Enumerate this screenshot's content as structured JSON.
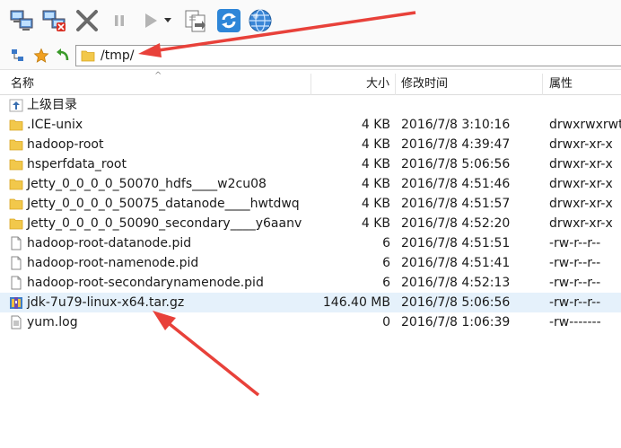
{
  "address": {
    "path": "/tmp/"
  },
  "columns": {
    "name": "名称",
    "size": "大小",
    "modified": "修改时间",
    "attributes": "属性"
  },
  "parent_dir": {
    "label": "上级目录"
  },
  "files": [
    {
      "type": "folder",
      "name": ".ICE-unix",
      "size": "4 KB",
      "modified": "2016/7/8 3:10:16",
      "attributes": "drwxrwxrwt"
    },
    {
      "type": "folder",
      "name": "hadoop-root",
      "size": "4 KB",
      "modified": "2016/7/8 4:39:47",
      "attributes": "drwxr-xr-x"
    },
    {
      "type": "folder",
      "name": "hsperfdata_root",
      "size": "4 KB",
      "modified": "2016/7/8 5:06:56",
      "attributes": "drwxr-xr-x"
    },
    {
      "type": "folder",
      "name": "Jetty_0_0_0_0_50070_hdfs____w2cu08",
      "size": "4 KB",
      "modified": "2016/7/8 4:51:46",
      "attributes": "drwxr-xr-x"
    },
    {
      "type": "folder",
      "name": "Jetty_0_0_0_0_50075_datanode____hwtdwq",
      "size": "4 KB",
      "modified": "2016/7/8 4:51:57",
      "attributes": "drwxr-xr-x"
    },
    {
      "type": "folder",
      "name": "Jetty_0_0_0_0_50090_secondary____y6aanv",
      "size": "4 KB",
      "modified": "2016/7/8 4:52:20",
      "attributes": "drwxr-xr-x"
    },
    {
      "type": "file",
      "name": "hadoop-root-datanode.pid",
      "size": "6",
      "modified": "2016/7/8 4:51:51",
      "attributes": "-rw-r--r--"
    },
    {
      "type": "file",
      "name": "hadoop-root-namenode.pid",
      "size": "6",
      "modified": "2016/7/8 4:51:41",
      "attributes": "-rw-r--r--"
    },
    {
      "type": "file",
      "name": "hadoop-root-secondarynamenode.pid",
      "size": "6",
      "modified": "2016/7/8 4:52:13",
      "attributes": "-rw-r--r--"
    },
    {
      "type": "archive",
      "name": "jdk-7u79-linux-x64.tar.gz",
      "size": "146.40 MB",
      "modified": "2016/7/8 5:06:56",
      "attributes": "-rw-r--r--",
      "selected": true
    },
    {
      "type": "textfile",
      "name": "yum.log",
      "size": "0",
      "modified": "2016/7/8 1:06:39",
      "attributes": "-rw-------"
    }
  ],
  "toolbar_icons": [
    "connect-icon",
    "disconnect-icon",
    "delete-icon",
    "pause-icon",
    "play-icon",
    "dropdown-icon",
    "transfer-icon",
    "refresh-icon",
    "globe-icon"
  ],
  "colors": {
    "annotation_arrow": "#e8413a",
    "folder": "#f2c84b",
    "selection": "#e5f1fb"
  }
}
